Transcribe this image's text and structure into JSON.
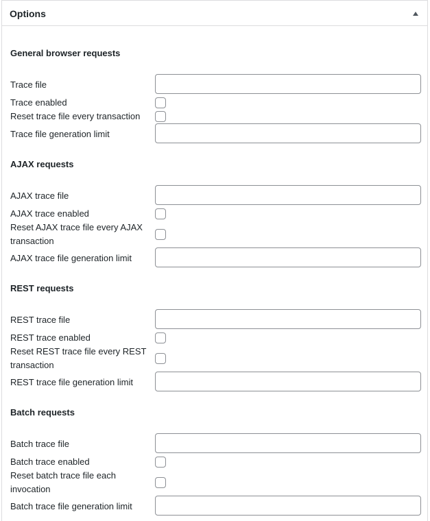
{
  "panel": {
    "title": "Options",
    "toggle_icon": "triangle-up-icon"
  },
  "sections": {
    "general": {
      "title": "General browser requests",
      "trace_file_label": "Trace file",
      "trace_file_value": "",
      "trace_enabled_label": "Trace enabled",
      "trace_enabled_checked": false,
      "reset_label": "Reset trace file every transaction",
      "reset_checked": false,
      "limit_label": "Trace file generation limit",
      "limit_value": ""
    },
    "ajax": {
      "title": "AJAX requests",
      "trace_file_label": "AJAX trace file",
      "trace_file_value": "",
      "trace_enabled_label": "AJAX trace enabled",
      "trace_enabled_checked": false,
      "reset_label": "Reset AJAX trace file every AJAX transaction",
      "reset_checked": false,
      "limit_label": "AJAX trace file generation limit",
      "limit_value": ""
    },
    "rest": {
      "title": "REST requests",
      "trace_file_label": "REST trace file",
      "trace_file_value": "",
      "trace_enabled_label": "REST trace enabled",
      "trace_enabled_checked": false,
      "reset_label": "Reset REST trace file every REST transaction",
      "reset_checked": false,
      "limit_label": "REST trace file generation limit",
      "limit_value": ""
    },
    "batch": {
      "title": "Batch requests",
      "trace_file_label": "Batch trace file",
      "trace_file_value": "",
      "trace_enabled_label": "Batch trace enabled",
      "trace_enabled_checked": false,
      "reset_label": "Reset batch trace file each invocation",
      "reset_checked": false,
      "limit_label": "Batch trace file generation limit",
      "limit_value": ""
    }
  }
}
